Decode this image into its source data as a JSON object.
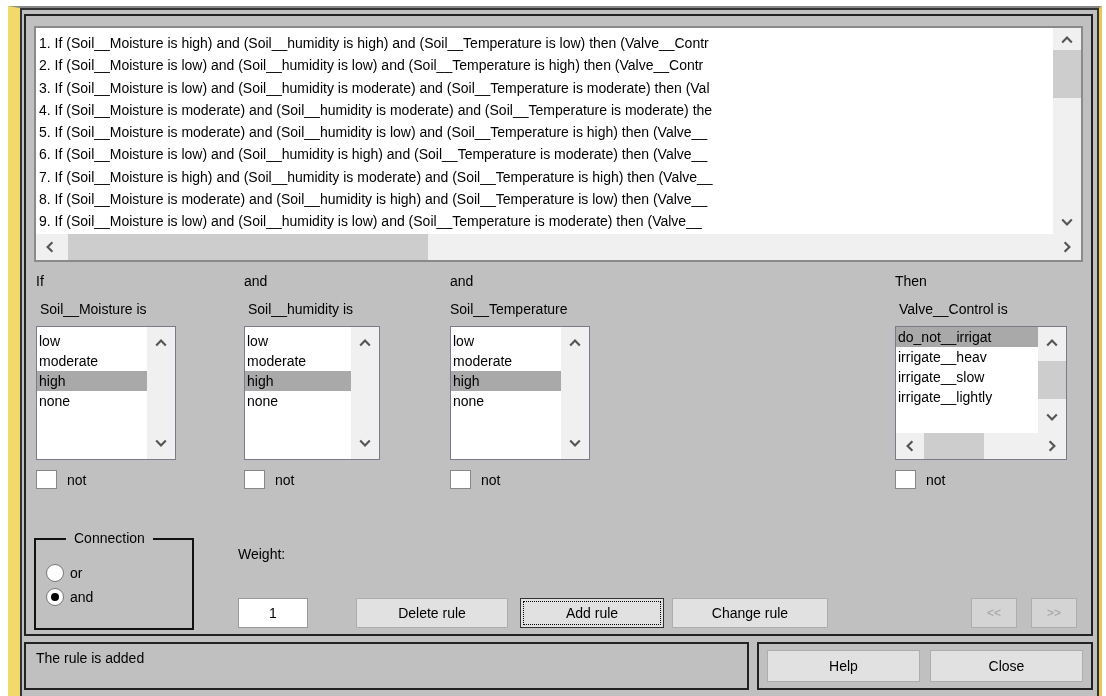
{
  "rules": [
    "1. If (Soil__Moisture is high) and (Soil__humidity is high) and (Soil__Temperature is low) then (Valve__Contr",
    "2. If (Soil__Moisture is low) and (Soil__humidity is low) and (Soil__Temperature is high) then (Valve__Contr",
    "3. If (Soil__Moisture is low) and (Soil__humidity is moderate) and (Soil__Temperature is moderate) then (Val",
    "4. If (Soil__Moisture is moderate) and (Soil__humidity is moderate) and (Soil__Temperature is moderate) the",
    "5. If (Soil__Moisture is moderate) and (Soil__humidity is low) and (Soil__Temperature is high) then (Valve__",
    "6. If (Soil__Moisture is low) and (Soil__humidity is high) and (Soil__Temperature is moderate) then (Valve__",
    "7. If (Soil__Moisture is high) and (Soil__humidity is moderate) and (Soil__Temperature is high) then (Valve__",
    "8. If (Soil__Moisture is moderate) and (Soil__humidity is high) and (Soil__Temperature is low) then (Valve__",
    "9. If (Soil__Moisture is low) and (Soil__humidity is low) and (Soil__Temperature is moderate) then (Valve__"
  ],
  "inputs": [
    {
      "connector": "If",
      "variable": "Soil__Moisture is",
      "options": [
        {
          "label": "low",
          "selected": false
        },
        {
          "label": "moderate",
          "selected": false
        },
        {
          "label": "high",
          "selected": true
        },
        {
          "label": "none",
          "selected": false
        }
      ],
      "not_label": "not",
      "not_checked": false
    },
    {
      "connector": "and",
      "variable": "Soil__humidity is",
      "options": [
        {
          "label": "low",
          "selected": false
        },
        {
          "label": "moderate",
          "selected": false
        },
        {
          "label": "high",
          "selected": true
        },
        {
          "label": "none",
          "selected": false
        }
      ],
      "not_label": "not",
      "not_checked": false
    },
    {
      "connector": "and",
      "variable": "Soil__Temperature",
      "options": [
        {
          "label": "low",
          "selected": false
        },
        {
          "label": "moderate",
          "selected": false
        },
        {
          "label": "high",
          "selected": true
        },
        {
          "label": "none",
          "selected": false
        }
      ],
      "not_label": "not",
      "not_checked": false
    }
  ],
  "output": {
    "connector": "Then",
    "variable": "Valve__Control is",
    "options": [
      {
        "label": "do_not__irrigat",
        "selected": true
      },
      {
        "label": "irrigate__heav",
        "selected": false
      },
      {
        "label": "irrigate__slow",
        "selected": false
      },
      {
        "label": "irrigate__lightly",
        "selected": false
      }
    ],
    "not_label": "not",
    "not_checked": false
  },
  "connection": {
    "title": "Connection",
    "options": [
      {
        "label": "or",
        "selected": false
      },
      {
        "label": "and",
        "selected": true
      }
    ]
  },
  "weight": {
    "label": "Weight:",
    "value": "1"
  },
  "buttons": [
    {
      "label": "Delete rule",
      "focused": false
    },
    {
      "label": "Add rule",
      "focused": true
    },
    {
      "label": "Change rule",
      "focused": false
    }
  ],
  "nav": [
    {
      "label": "<<",
      "disabled": true
    },
    {
      "label": ">>",
      "disabled": true
    }
  ],
  "status": "The rule is added",
  "footer_buttons": [
    "Help",
    "Close"
  ]
}
